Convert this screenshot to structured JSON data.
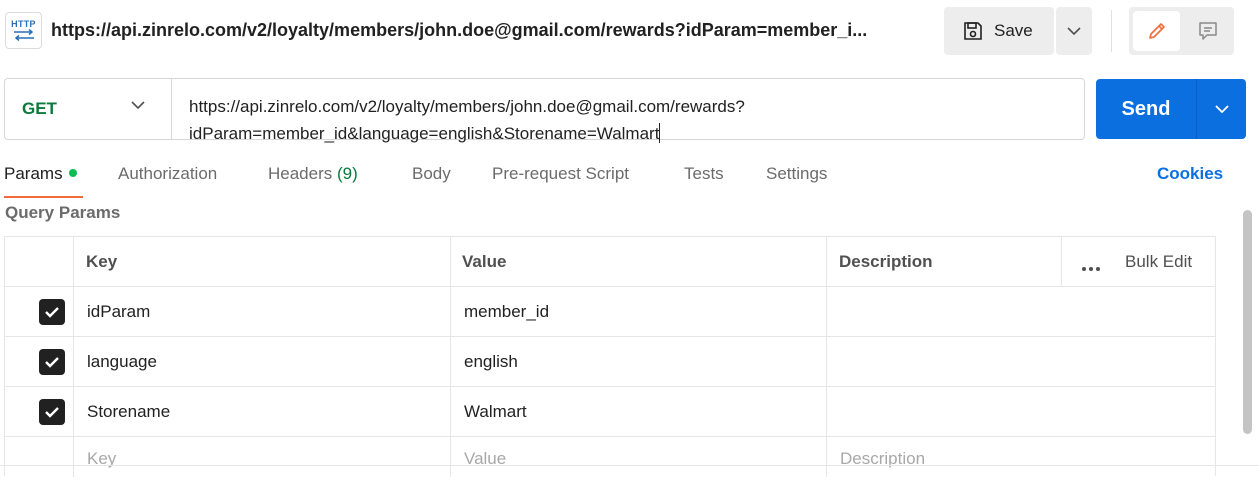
{
  "header": {
    "icon_text": "HTTP",
    "title": "https://api.zinrelo.com/v2/loyalty/members/john.doe@gmail.com/rewards?idParam=member_i...",
    "save_label": "Save"
  },
  "request": {
    "method": "GET",
    "url_line1": "https://api.zinrelo.com/v2/loyalty/members/john.doe@gmail.com/rewards?",
    "url_line2": "idParam=member_id&language=english&Storename=Walmart",
    "send_label": "Send"
  },
  "tabs": [
    {
      "label": "Params"
    },
    {
      "label": "Authorization"
    },
    {
      "label": "Headers",
      "count": "(9)"
    },
    {
      "label": "Body"
    },
    {
      "label": "Pre-request Script"
    },
    {
      "label": "Tests"
    },
    {
      "label": "Settings"
    }
  ],
  "cookies_label": "Cookies",
  "query_params": {
    "title": "Query Params",
    "columns": {
      "key": "Key",
      "value": "Value",
      "description": "Description",
      "bulk_edit": "Bulk Edit"
    },
    "rows": [
      {
        "key": "idParam",
        "value": "member_id",
        "checked": true
      },
      {
        "key": "language",
        "value": "english",
        "checked": true
      },
      {
        "key": "Storename",
        "value": "Walmart",
        "checked": true
      }
    ],
    "placeholders": {
      "key": "Key",
      "value": "Value",
      "description": "Description"
    }
  },
  "colors": {
    "accent": "#0b6fe0",
    "method": "#0b7a3b",
    "tab_indicator": "#f26b3a",
    "status_dot": "#0cbb52"
  }
}
